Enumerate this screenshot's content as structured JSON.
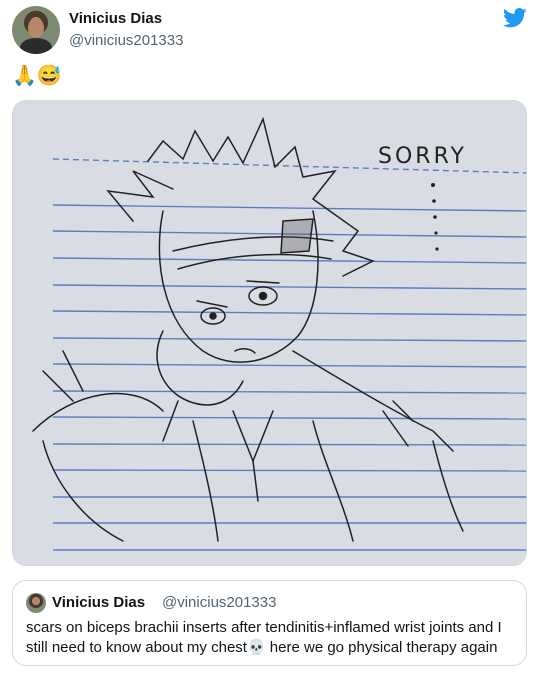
{
  "author": {
    "name": "Vinicius Dias",
    "handle": "@vinicius201333"
  },
  "brand_icon": "twitter-bird-icon",
  "tweet_text": "🙏😅",
  "media": {
    "drawing_text": "SORRY",
    "colors": {
      "paper": "#d9dce3",
      "rule_line": "#5a7fc1",
      "ink": "#222222"
    }
  },
  "quoted_tweet": {
    "name": "Vinicius Dias",
    "handle": "@vinicius201333",
    "text": "scars on biceps brachii inserts after tendinitis+inflamed wrist joints and I still need to know about my chest💀 here we go physical therapy again"
  },
  "colors": {
    "twitter_blue": "#1d9bf0",
    "secondary_text": "#536471",
    "border": "#cfd9de"
  }
}
